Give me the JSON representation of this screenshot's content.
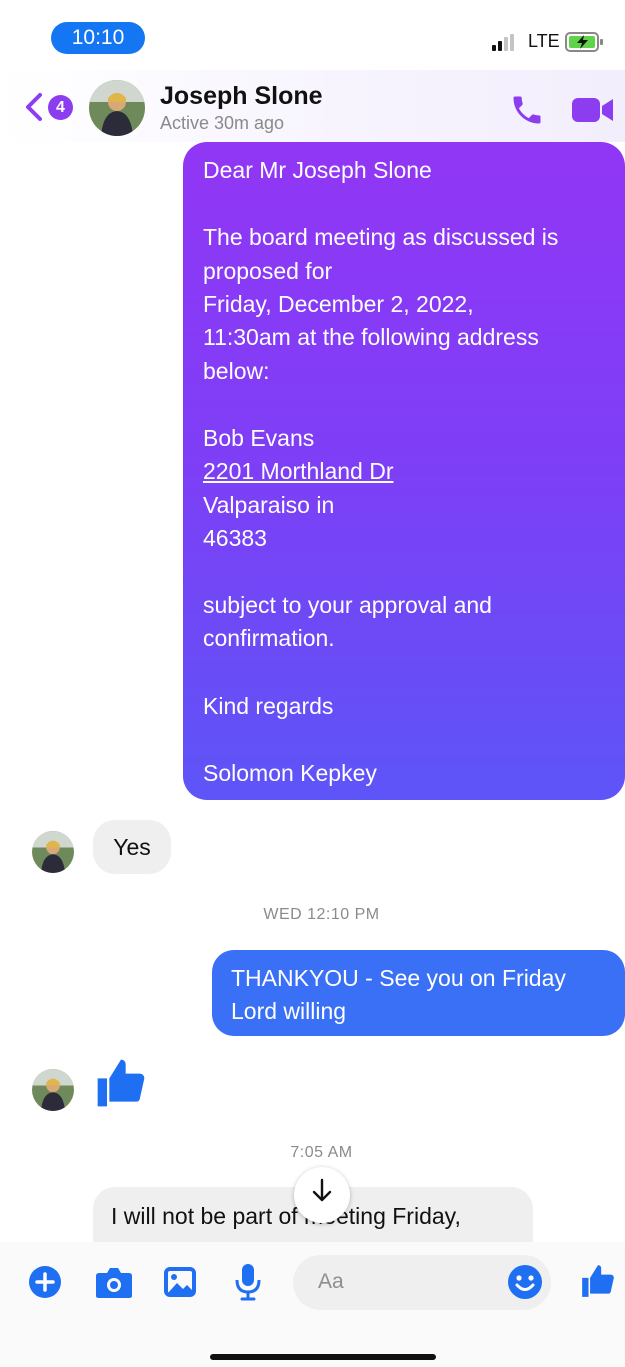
{
  "status_bar": {
    "time": "10:10",
    "network": "LTE"
  },
  "header": {
    "back_count": "4",
    "contact_name": "Joseph Slone",
    "status": "Active 30m ago"
  },
  "messages": {
    "outgoing_letter": [
      "Dear Mr Joseph Slone",
      "The board meeting as discussed is",
      "proposed for",
      "Friday, December 2, 2022,",
      "11:30am at the following address",
      "below:",
      "Bob Evans",
      "2201 Morthland Dr",
      "Valparaiso in",
      "46383",
      "subject to your approval and",
      "confirmation.",
      "Kind regards",
      "Solomon Kepkey"
    ],
    "reply_yes": "Yes",
    "timestamp_1": "WED 12:10 PM",
    "outgoing_thanks": [
      "THANKYOU - See you on Friday",
      "Lord willing"
    ],
    "timestamp_2": "7:05 AM",
    "incoming_partial": [
      "I will not be part of meeting Friday,"
    ]
  },
  "composer": {
    "placeholder": "Aa"
  },
  "colors": {
    "accent_purple": "#8c3df0",
    "messenger_blue": "#1e6ff1",
    "bubble_gradient_top": "#9136f5",
    "bubble_gradient_bottom": "#5d55f7",
    "incoming_bubble": "#efefef"
  },
  "icons": {
    "header": [
      "back-chevron-icon",
      "phone-icon",
      "video-camera-icon"
    ],
    "composer": [
      "plus-icon",
      "camera-icon",
      "image-icon",
      "microphone-icon",
      "emoji-icon",
      "thumbs-up-icon"
    ]
  }
}
